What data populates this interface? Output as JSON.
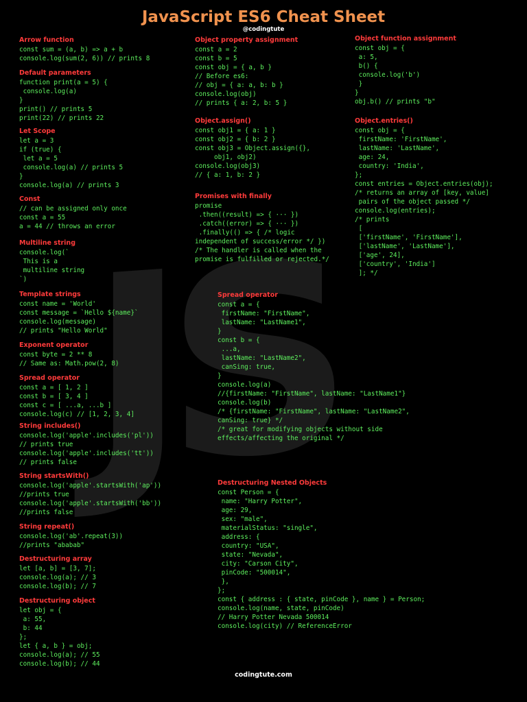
{
  "header": {
    "title": "JavaScript ES6 Cheat Sheet",
    "handle": "@codingtute"
  },
  "footer": {
    "text": "codingtute.com"
  },
  "watermark": {
    "text": "JS"
  },
  "colors": {
    "title": "#f0924e",
    "heading": "#ff3b3b",
    "code": "#5ef05e",
    "background": "#000000"
  },
  "sections": {
    "arrow": {
      "heading": "Arrow function",
      "lines": [
        "const sum = (a, b) => a + b",
        "console.log(sum(2, 6)) // prints 8"
      ]
    },
    "default_params": {
      "heading": "Default parameters",
      "lines": [
        "function print(a = 5) {",
        " console.log(a)",
        "}",
        "print() // prints 5",
        "print(22) // prints 22"
      ]
    },
    "let_scope": {
      "heading": "Let Scope",
      "lines": [
        "let a = 3",
        "if (true) {",
        " let a = 5",
        " console.log(a) // prints 5",
        "}",
        "console.log(a) // prints 3"
      ]
    },
    "const": {
      "heading": "Const",
      "lines": [
        "// can be assigned only once",
        "const a = 55",
        "a = 44 // throws an error"
      ]
    },
    "multiline": {
      "heading": "Multiline string",
      "lines": [
        "console.log(`",
        " This is a",
        " multiline string",
        "`)"
      ]
    },
    "template": {
      "heading": "Template strings",
      "lines": [
        "const name = 'World'",
        "const message = `Hello ${name}`",
        "console.log(message)",
        "// prints \"Hello World\""
      ]
    },
    "exponent": {
      "heading": "Exponent operator",
      "lines": [
        "const byte = 2 ** 8",
        "// Same as: Math.pow(2, 8)"
      ]
    },
    "spread_array": {
      "heading": "Spread operator",
      "lines": [
        "const a = [ 1, 2 ]",
        "const b = [ 3, 4 ]",
        "const c = [ ...a, ...b ]",
        "console.log(c) // [1, 2, 3, 4]"
      ]
    },
    "includes": {
      "heading": "String includes()",
      "lines": [
        "console.log('apple'.includes('pl'))",
        "// prints true",
        "console.log('apple'.includes('tt'))",
        "// prints false"
      ]
    },
    "starts_with": {
      "heading": "String startsWith()",
      "lines": [
        "console.log('apple'.startsWith('ap'))",
        "//prints true",
        "console.log('apple'.startsWith('bb'))",
        "//prints false"
      ]
    },
    "repeat": {
      "heading": "String repeat()",
      "lines": [
        "console.log('ab'.repeat(3))",
        "//prints \"ababab\""
      ]
    },
    "destr_array": {
      "heading": "Destructuring array",
      "lines": [
        "let [a, b] = [3, 7];",
        "console.log(a); // 3",
        "console.log(b); // 7"
      ]
    },
    "destr_object": {
      "heading": "Destructuring object",
      "lines": [
        "let obj = {",
        " a: 55,",
        " b: 44",
        "};",
        "let { a, b } = obj;",
        "console.log(a); // 55",
        "console.log(b); // 44"
      ]
    },
    "obj_prop": {
      "heading": "Object property assignment",
      "lines": [
        "const a = 2",
        "const b = 5",
        "const obj = { a, b }",
        "// Before es6:",
        "// obj = { a: a, b: b }",
        "console.log(obj)",
        "// prints { a: 2, b: 5 }"
      ]
    },
    "obj_assign": {
      "heading": "Object.assign()",
      "lines": [
        "const obj1 = { a: 1 }",
        "const obj2 = { b: 2 }",
        "const obj3 = Object.assign({},",
        "     obj1, obj2)",
        "console.log(obj3)",
        "// { a: 1, b: 2 }"
      ]
    },
    "promises": {
      "heading": "Promises with finally",
      "lines": [
        "promise",
        " .then((result) => { ··· })",
        " .catch((error) => { ··· })",
        " .finally(() => { /* logic",
        "independent of success/error */ })",
        "/* The handler is called when the",
        "promise is fulfilled or rejected.*/"
      ]
    },
    "obj_func": {
      "heading": "Object function assignment",
      "lines": [
        "const obj = {",
        " a: 5,",
        " b() {",
        " console.log('b')",
        " }",
        "}",
        "obj.b() // prints \"b\""
      ]
    },
    "entries": {
      "heading": "Object.entries()",
      "lines": [
        "const obj = {",
        " firstName: 'FirstName',",
        " lastName: 'LastName',",
        " age: 24,",
        " country: 'India',",
        "};",
        "const entries = Object.entries(obj);",
        "/* returns an array of [key, value]",
        " pairs of the object passed */",
        "console.log(entries);",
        "/* prints",
        " [",
        " ['firstName', 'FirstName'],",
        " ['lastName', 'LastName'],",
        " ['age', 24],",
        " ['country', 'India']",
        " ]; */"
      ]
    },
    "spread_object": {
      "heading": "Spread operator",
      "lines": [
        "const a = {",
        " firstName: \"FirstName\",",
        " lastName: \"LastName1\",",
        "}",
        "const b = {",
        " ...a,",
        " lastName: \"LastName2\",",
        " canSing: true,",
        "}",
        "console.log(a)",
        "//{firstName: \"FirstName\", lastName: \"LastName1\"}",
        "console.log(b)",
        "/* {firstName: \"FirstName\", lastName: \"LastName2\",",
        "canSing: true} */",
        "/* great for modifying objects without side",
        "effects/affecting the original */"
      ]
    },
    "destr_nested": {
      "heading": "Destructuring Nested Objects",
      "lines": [
        "const Person = {",
        " name: \"Harry Potter\",",
        " age: 29,",
        " sex: \"male\",",
        " materialStatus: \"single\",",
        " address: {",
        " country: \"USA\",",
        " state: \"Nevada\",",
        " city: \"Carson City\",",
        " pinCode: \"500014\",",
        " },",
        "};",
        "const { address : { state, pinCode }, name } = Person;",
        "console.log(name, state, pinCode)",
        "// Harry Potter Nevada 500014",
        "console.log(city) // ReferenceError"
      ]
    }
  }
}
